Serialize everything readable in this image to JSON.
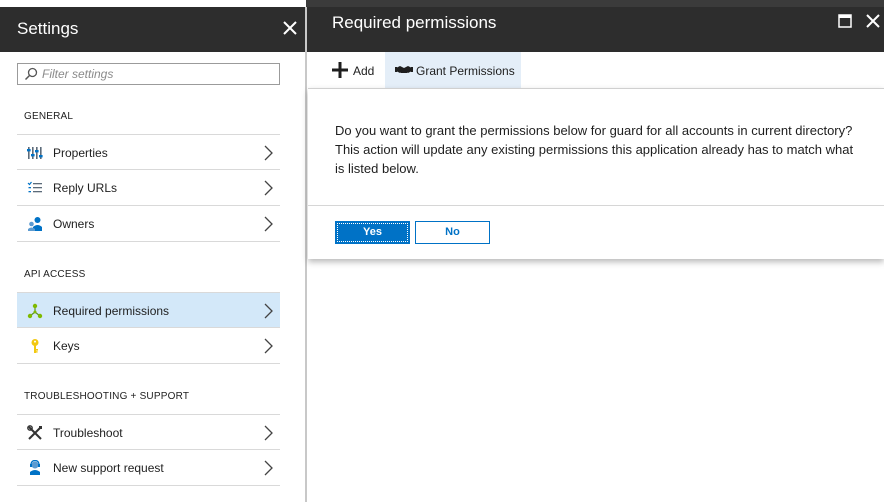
{
  "settings_blade": {
    "title": "Settings",
    "filter_placeholder": "Filter settings",
    "sections": {
      "general": "GENERAL",
      "api_access": "API ACCESS",
      "troubleshooting": "TROUBLESHOOTING + SUPPORT"
    },
    "items": {
      "properties": "Properties",
      "reply_urls": "Reply URLs",
      "owners": "Owners",
      "required_permissions": "Required permissions",
      "keys": "Keys",
      "troubleshoot": "Troubleshoot",
      "new_support_request": "New support request"
    },
    "selected_item": "Required permissions"
  },
  "permissions_blade": {
    "title": "Required permissions",
    "commands": {
      "add": "Add",
      "grant": "Grant Permissions"
    },
    "dialog": {
      "message": "Do you want to grant the permissions below for guard for all accounts in current directory? This action will update any existing permissions this application already has to match what is listed below.",
      "yes": "Yes",
      "no": "No"
    }
  },
  "colors": {
    "header_bg": "#2d2d2d",
    "accent": "#0072c6",
    "selected_bg": "#d3e8f9"
  },
  "icons": [
    "close-icon",
    "search-icon",
    "properties-icon",
    "reply-urls-icon",
    "owners-icon",
    "required-permissions-icon",
    "key-icon",
    "troubleshoot-icon",
    "support-icon",
    "chevron-right-icon",
    "maximize-icon",
    "add-icon",
    "grant-permissions-icon"
  ]
}
